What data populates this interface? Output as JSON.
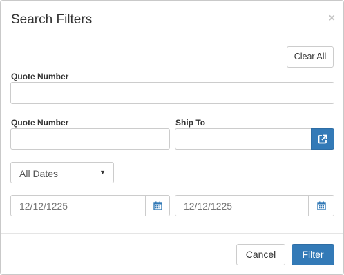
{
  "dialog": {
    "title": "Search Filters",
    "close_glyph": "×"
  },
  "clear_all_label": "Clear All",
  "fields": {
    "quote_number_top_label": "Quote Number",
    "quote_number_top_value": "",
    "quote_number_label": "Quote Number",
    "quote_number_value": "",
    "ship_to_label": "Ship To",
    "ship_to_value": ""
  },
  "date_filter": {
    "selected": "All Dates",
    "start_placeholder": "12/12/1225",
    "end_placeholder": "12/12/1225"
  },
  "footer": {
    "cancel_label": "Cancel",
    "filter_label": "Filter"
  },
  "colors": {
    "primary": "#337ab7",
    "border": "#cccccc"
  },
  "icons": {
    "ship_to_lookup": "external-link-icon",
    "calendar": "calendar-icon"
  }
}
